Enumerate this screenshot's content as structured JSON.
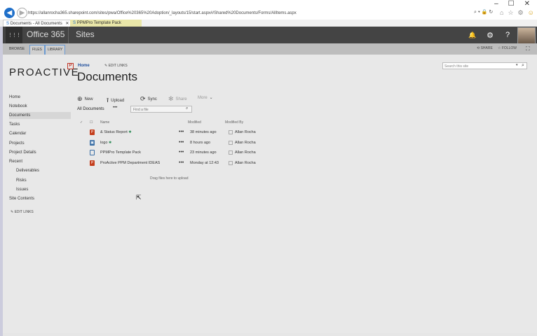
{
  "browser": {
    "window_controls": [
      "–",
      "☐",
      "✕"
    ],
    "url": "https://allanrocha365.sharepoint.com/sites/pwa/Office%20365%20Adoption/_layouts/15/start.aspx#/Shared%20Documents/Forms/AllItems.aspx",
    "url_controls": "⌕ ▾ 🔒 ↻",
    "tabs": [
      {
        "label": "Documents - All Documents"
      },
      {
        "label": "PPMPro Template Pack"
      }
    ],
    "tab_close": "✕"
  },
  "suitebar": {
    "waffle": "⋮⋮⋮",
    "brand": "Office 365",
    "sites": "Sites",
    "bell": "🔔",
    "gear": "⚙",
    "help": "?"
  },
  "ribbon": {
    "tabs": [
      "BROWSE",
      "FILES",
      "LIBRARY"
    ],
    "share": "SHARE",
    "follow": "FOLLOW",
    "focus": "⛶"
  },
  "site": {
    "logo": "PROACTIVE",
    "logo_mark": "P",
    "breadcrumb_home": "Home",
    "edit_links": "EDIT LINKS",
    "title": "Documents",
    "search_placeholder": "Search this site"
  },
  "nav": {
    "items": [
      "Home",
      "Notebook",
      "Documents",
      "Tasks",
      "Calendar",
      "Projects",
      "Project Details",
      "Recent"
    ],
    "recent_items": [
      "Deliverables",
      "Risks",
      "Issues"
    ],
    "site_contents": "Site Contents",
    "edit_links": "EDIT LINKS"
  },
  "commands": {
    "new": "New",
    "upload": "Upload",
    "sync": "Sync",
    "share": "Share",
    "more": "More"
  },
  "view": {
    "name": "All Documents",
    "more": "•••",
    "find_placeholder": "Find a file"
  },
  "list": {
    "headers": {
      "check": "✓",
      "type": "☐",
      "name": "Name",
      "modified": "Modified",
      "modified_by": "Modified By"
    },
    "rows": [
      {
        "type": "pdf",
        "type_glyph": "P",
        "name": "& Status Report",
        "new_mark": "✱",
        "modified": "38 minutes ago",
        "modified_by": "Allan Rocha"
      },
      {
        "type": "img",
        "type_glyph": "▣",
        "name": "logo",
        "new_mark": "✱",
        "modified": "8 hours ago",
        "modified_by": "Allan Rocha"
      },
      {
        "type": "folder",
        "type_glyph": "",
        "name": "PPMPro Template Pack",
        "new_mark": "",
        "modified": "23 minutes ago",
        "modified_by": "Allan Rocha"
      },
      {
        "type": "pdf",
        "type_glyph": "P",
        "name": "ProActive PPM Department IDEAS",
        "new_mark": "",
        "modified": "Monday at 12:43",
        "modified_by": "Allan Rocha"
      }
    ],
    "ellipsis": "•••",
    "drag_hint": "Drag files here to upload"
  }
}
